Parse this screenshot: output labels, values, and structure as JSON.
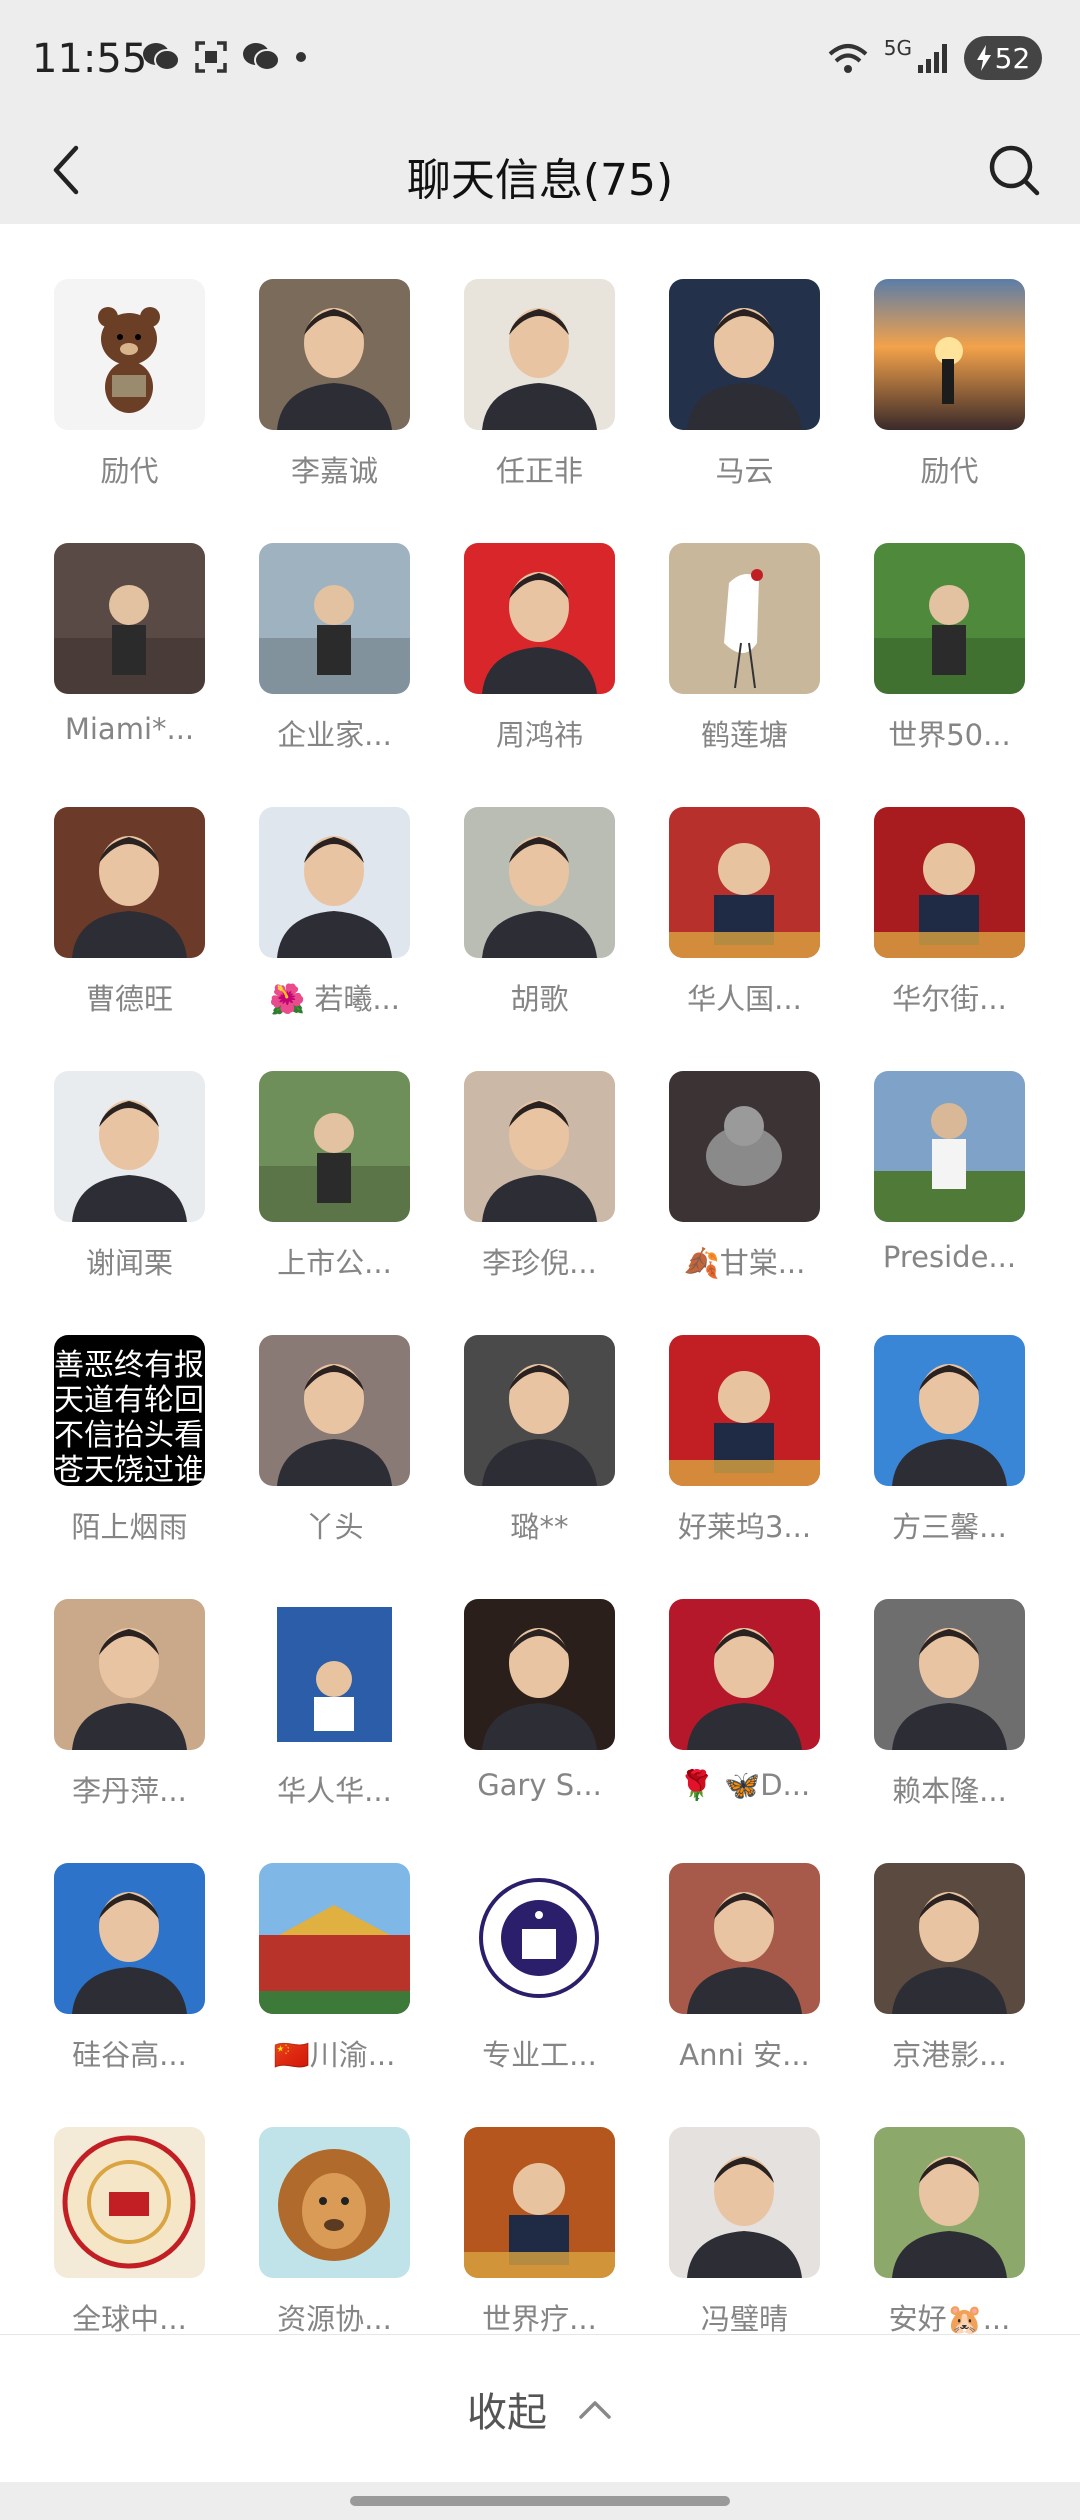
{
  "status_bar": {
    "time": "11:55",
    "network": "5G",
    "battery": "52",
    "icons": [
      "wechat-icon",
      "scan-icon",
      "wechat-icon",
      "dot-icon"
    ]
  },
  "header": {
    "title": "聊天信息(75)",
    "back_icon": "chevron-left-icon",
    "search_icon": "search-icon"
  },
  "members": [
    {
      "name": "励代",
      "avatar": "cartoon-bear",
      "color": "#f4f4f4"
    },
    {
      "name": "李嘉诚",
      "avatar": "portrait",
      "color": "#7a6b5a"
    },
    {
      "name": "任正非",
      "avatar": "portrait",
      "color": "#e8e4dc"
    },
    {
      "name": "马云",
      "avatar": "portrait",
      "color": "#23324a"
    },
    {
      "name": "励代",
      "avatar": "sunset-landscape",
      "color": "#d9823a"
    },
    {
      "name": "Miami*...",
      "avatar": "photo",
      "color": "#5a4a45"
    },
    {
      "name": "企业家...",
      "avatar": "photo",
      "color": "#9fb2bf"
    },
    {
      "name": "周鸿祎",
      "avatar": "portrait",
      "color": "#d8262a"
    },
    {
      "name": "鹤莲塘",
      "avatar": "crane-painting",
      "color": "#c9b79c"
    },
    {
      "name": "世界50...",
      "avatar": "photo",
      "color": "#4f8a3c"
    },
    {
      "name": "曹德旺",
      "avatar": "portrait",
      "color": "#6b3a28"
    },
    {
      "name": "🌺 若曦...",
      "avatar": "portrait",
      "color": "#dfe6ee"
    },
    {
      "name": "胡歌",
      "avatar": "portrait",
      "color": "#b9bdb4"
    },
    {
      "name": "华人国...",
      "avatar": "poster",
      "color": "#b8302c"
    },
    {
      "name": "华尔街...",
      "avatar": "poster",
      "color": "#a81c1f"
    },
    {
      "name": "谢闻栗",
      "avatar": "portrait",
      "color": "#e9ecef"
    },
    {
      "name": "上市公...",
      "avatar": "photo",
      "color": "#6f8f5a"
    },
    {
      "name": "李珍倪...",
      "avatar": "portrait",
      "color": "#cbb8a6"
    },
    {
      "name": "🍂甘棠...",
      "avatar": "photo-cat",
      "color": "#3c3434"
    },
    {
      "name": "Preside...",
      "avatar": "golf-photo",
      "color": "#7fa3c8"
    },
    {
      "name": "陌上烟雨",
      "avatar": "text-image",
      "color": "#000000"
    },
    {
      "name": "丫头",
      "avatar": "portrait",
      "color": "#8a7a75"
    },
    {
      "name": "璐**",
      "avatar": "portrait",
      "color": "#4a4a4a"
    },
    {
      "name": "好莱坞3...",
      "avatar": "poster",
      "color": "#c21f24"
    },
    {
      "name": "方三馨...",
      "avatar": "portrait",
      "color": "#3a86d6"
    },
    {
      "name": "李丹萍...",
      "avatar": "portrait",
      "color": "#c9a98a"
    },
    {
      "name": "华人华...",
      "avatar": "magazine-cover",
      "color": "#2c5da8"
    },
    {
      "name": "Gary S...",
      "avatar": "portrait",
      "color": "#2a1f1a"
    },
    {
      "name": "🌹 🦋D...",
      "avatar": "portrait",
      "color": "#b5182a"
    },
    {
      "name": "赖本隆...",
      "avatar": "portrait",
      "color": "#6e6e6e"
    },
    {
      "name": "硅谷高...",
      "avatar": "portrait",
      "color": "#2c73c9"
    },
    {
      "name": "🇨🇳川渝...",
      "avatar": "tiananmen-photo",
      "color": "#c23b2a"
    },
    {
      "name": "专业工...",
      "avatar": "lawyers-seal",
      "color": "#ffffff"
    },
    {
      "name": "Anni 安...",
      "avatar": "portrait",
      "color": "#a85a4a"
    },
    {
      "name": "京港影...",
      "avatar": "portrait",
      "color": "#5b4a3f"
    },
    {
      "name": "全球中...",
      "avatar": "round-seal",
      "color": "#f4ead8"
    },
    {
      "name": "资源协...",
      "avatar": "lion",
      "color": "#bfe3e8"
    },
    {
      "name": "世界疗...",
      "avatar": "poster",
      "color": "#b4561d"
    },
    {
      "name": "冯璧晴",
      "avatar": "portrait",
      "color": "#e4e1de"
    },
    {
      "name": "安好🐹...",
      "avatar": "portrait",
      "color": "#8ca86a"
    }
  ],
  "footer": {
    "collapse_label": "收起",
    "collapse_icon": "chevron-up-icon"
  }
}
